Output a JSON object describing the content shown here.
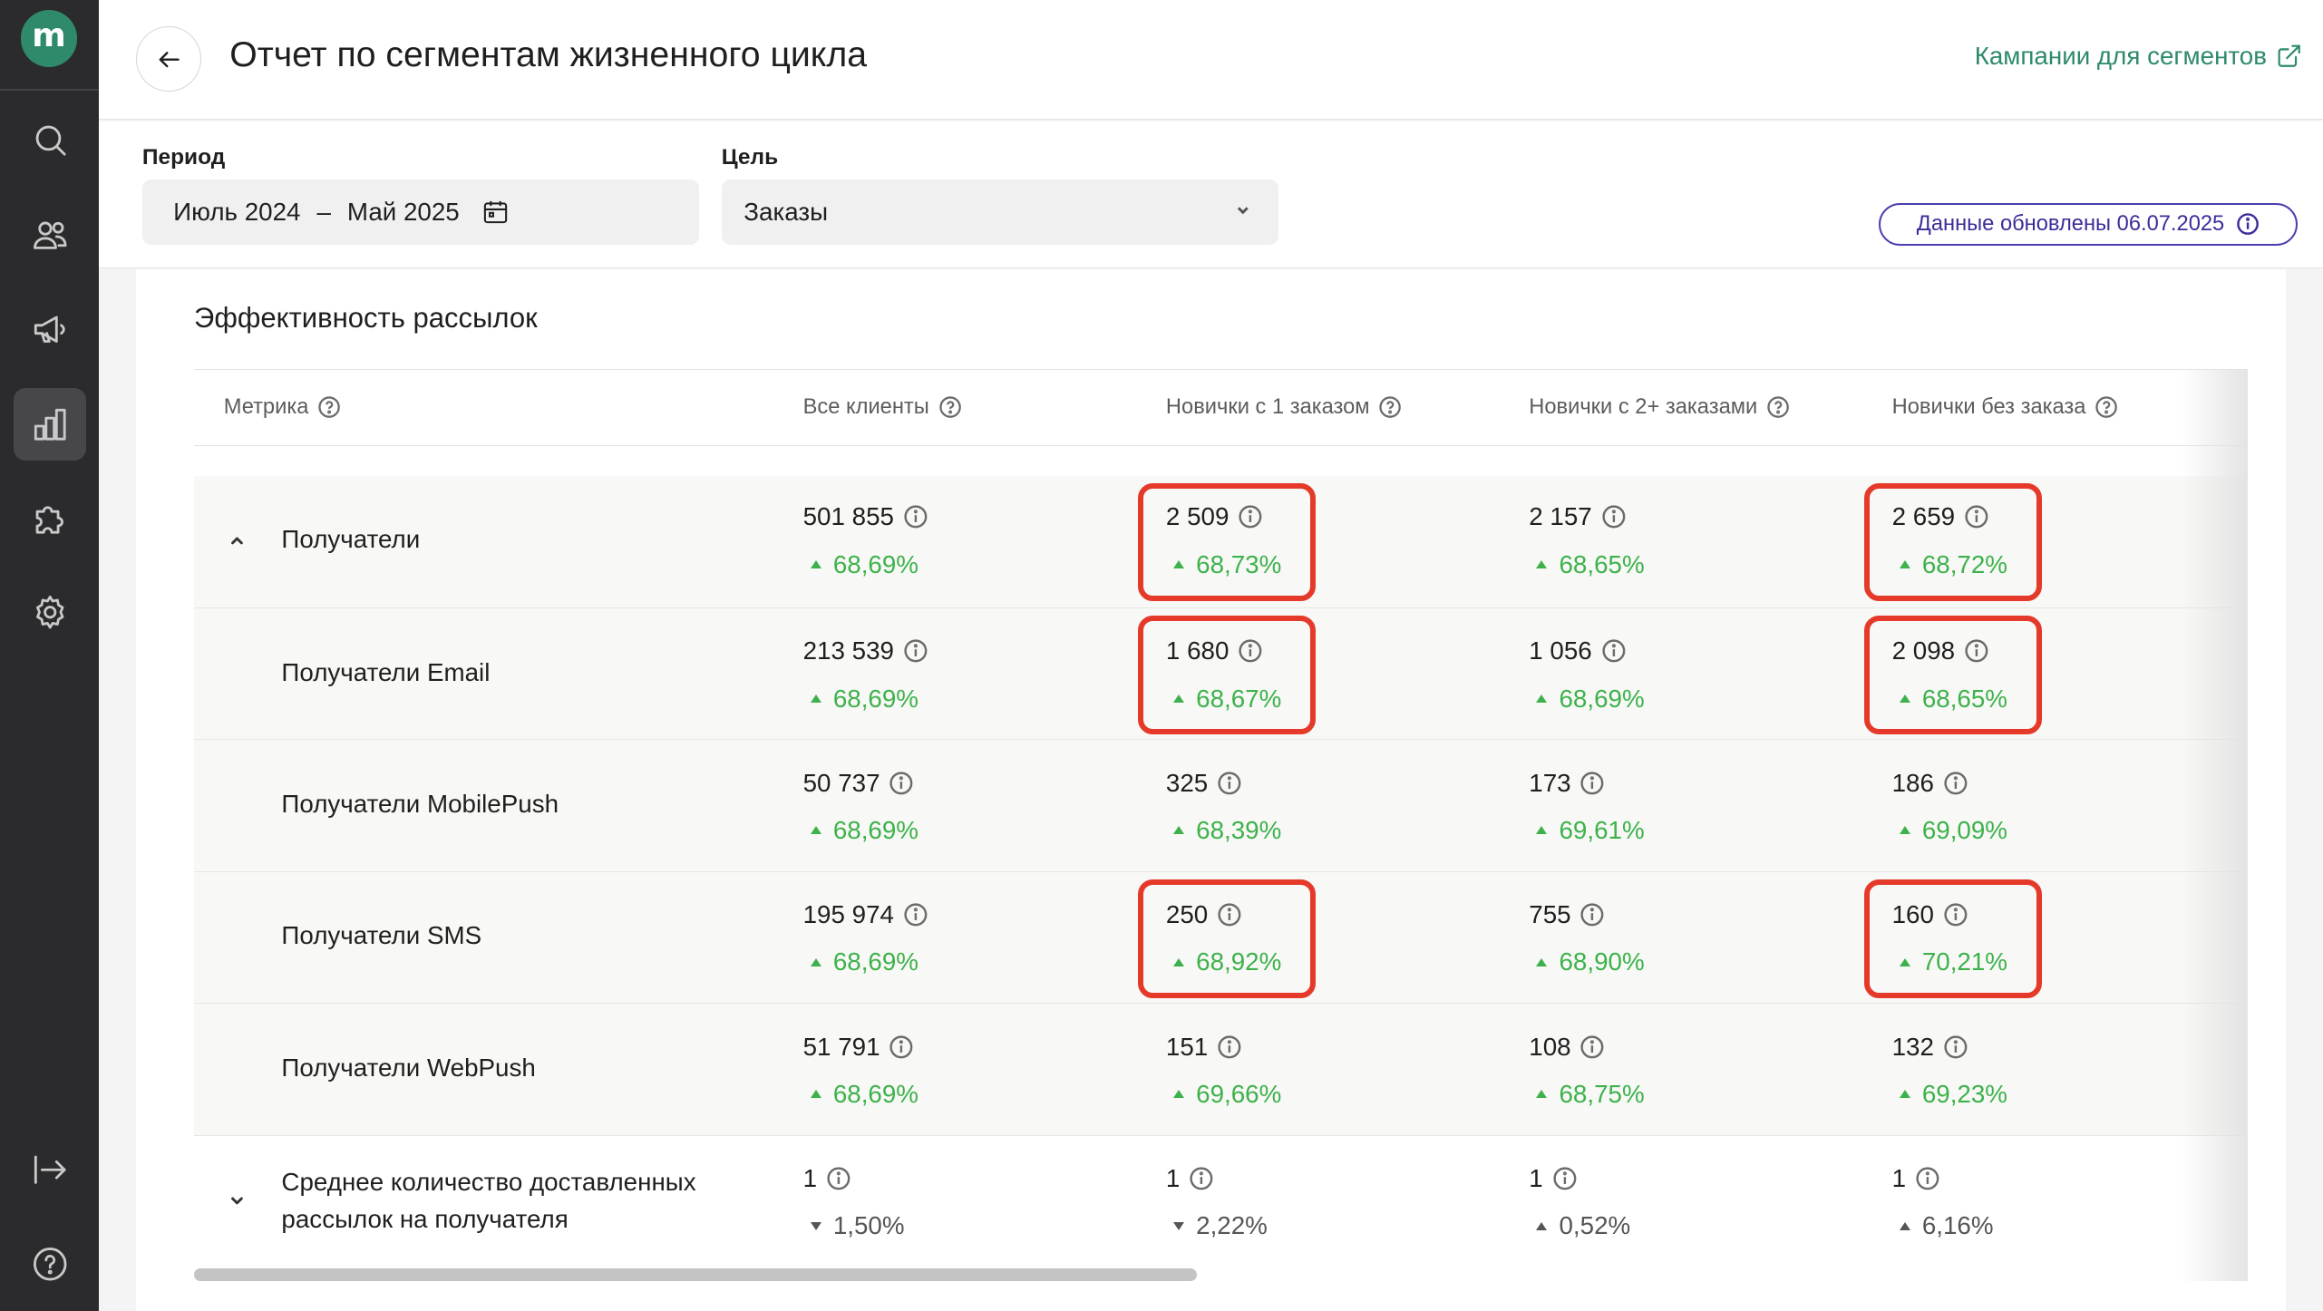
{
  "app": {
    "logo_letter": "m",
    "sidebar": [
      {
        "name": "search-icon",
        "active": false
      },
      {
        "name": "users-icon",
        "active": false
      },
      {
        "name": "megaphone-icon",
        "active": false
      },
      {
        "name": "chart-icon",
        "active": true
      },
      {
        "name": "puzzle-icon",
        "active": false
      },
      {
        "name": "gear-icon",
        "active": false
      },
      {
        "name": "logout-icon",
        "active": false
      },
      {
        "name": "help-icon",
        "active": false
      }
    ]
  },
  "header": {
    "title": "Отчет по сегментам жизненного цикла",
    "campaigns_link": "Кампании для сегментов"
  },
  "filters": {
    "period_label": "Период",
    "period_from": "Июль 2024",
    "period_sep": "–",
    "period_to": "Май 2025",
    "goal_label": "Цель",
    "goal_value": "Заказы",
    "updated": "Данные обновлены 06.07.2025"
  },
  "report": {
    "title": "Эффективность рассылок",
    "columns": [
      "Метрика",
      "Все клиенты",
      "Новички с 1 заказом",
      "Новички с 2+ заказами",
      "Новички без заказа"
    ],
    "rows": [
      {
        "label": "Получатели",
        "toggle": "up",
        "cells": [
          {
            "value": "501 855",
            "delta": "68,69%",
            "dir": "up"
          },
          {
            "value": "2 509",
            "delta": "68,73%",
            "dir": "up"
          },
          {
            "value": "2 157",
            "delta": "68,65%",
            "dir": "up"
          },
          {
            "value": "2 659",
            "delta": "68,72%",
            "dir": "up"
          }
        ]
      },
      {
        "label": "Получатели Email",
        "cells": [
          {
            "value": "213 539",
            "delta": "68,69%",
            "dir": "up"
          },
          {
            "value": "1 680",
            "delta": "68,67%",
            "dir": "up"
          },
          {
            "value": "1 056",
            "delta": "68,69%",
            "dir": "up"
          },
          {
            "value": "2 098",
            "delta": "68,65%",
            "dir": "up"
          }
        ]
      },
      {
        "label": "Получатели MobilePush",
        "cells": [
          {
            "value": "50 737",
            "delta": "68,69%",
            "dir": "up"
          },
          {
            "value": "325",
            "delta": "68,39%",
            "dir": "up"
          },
          {
            "value": "173",
            "delta": "69,61%",
            "dir": "up"
          },
          {
            "value": "186",
            "delta": "69,09%",
            "dir": "up"
          }
        ]
      },
      {
        "label": "Получатели SMS",
        "cells": [
          {
            "value": "195 974",
            "delta": "68,69%",
            "dir": "up"
          },
          {
            "value": "250",
            "delta": "68,92%",
            "dir": "up"
          },
          {
            "value": "755",
            "delta": "68,90%",
            "dir": "up"
          },
          {
            "value": "160",
            "delta": "70,21%",
            "dir": "up"
          }
        ]
      },
      {
        "label": "Получатели WebPush",
        "cells": [
          {
            "value": "51 791",
            "delta": "68,69%",
            "dir": "up"
          },
          {
            "value": "151",
            "delta": "69,66%",
            "dir": "up"
          },
          {
            "value": "108",
            "delta": "68,75%",
            "dir": "up"
          },
          {
            "value": "132",
            "delta": "69,23%",
            "dir": "up"
          }
        ]
      },
      {
        "label_lines": [
          "Среднее количество доставленных",
          "рассылок на получателя"
        ],
        "toggle": "down",
        "cells": [
          {
            "value": "1",
            "delta": "1,50%",
            "dir": "down"
          },
          {
            "value": "1",
            "delta": "2,22%",
            "dir": "down"
          },
          {
            "value": "1",
            "delta": "0,52%",
            "dir": "up-neutral"
          },
          {
            "value": "1",
            "delta": "6,16%",
            "dir": "up-neutral"
          }
        ]
      }
    ]
  },
  "colors": {
    "brand": "#2e8a6b",
    "positive": "#3db24b",
    "highlight": "#e53a2a",
    "badge": "#3b2e9a"
  }
}
